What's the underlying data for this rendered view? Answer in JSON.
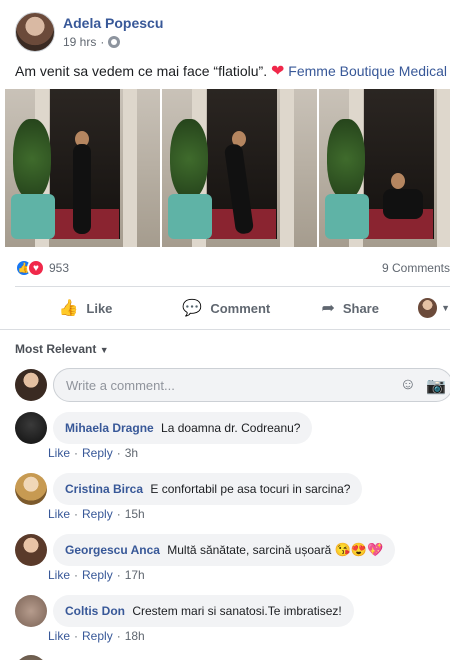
{
  "post": {
    "author": "Adela Popescu",
    "time": "19 hrs",
    "separator": "·",
    "text": "Am venit sa vedem ce mai face “flatiolu”.",
    "page_link": "Femme Boutique Medical",
    "photos_count_shown": 3
  },
  "reactions": {
    "count": "953",
    "comments": "9 Comments"
  },
  "actions": {
    "like": "Like",
    "comment": "Comment",
    "share": "Share"
  },
  "comments_section": {
    "sort_label": "Most Relevant",
    "write_placeholder": "Write a comment...",
    "comments": [
      {
        "author": "Mihaela Dragne",
        "text": "La doamna dr. Codreanu?",
        "emoji": "",
        "like": "Like",
        "reply": "Reply",
        "time": "3h"
      },
      {
        "author": "Cristina Birca",
        "text": "E confortabil pe asa tocuri in sarcina?",
        "emoji": "",
        "like": "Like",
        "reply": "Reply",
        "time": "15h"
      },
      {
        "author": "Georgescu Anca",
        "text": "Multă sănătate, sarcină ușoară",
        "emoji": "😘😍💖",
        "like": "Like",
        "reply": "Reply",
        "time": "17h"
      },
      {
        "author": "Coltis Don",
        "text": "Crestem mari si sanatosi.Te imbratisez!",
        "emoji": "",
        "like": "Like",
        "reply": "Reply",
        "time": "18h"
      }
    ]
  },
  "colors": {
    "link": "#385898",
    "like_blue": "#1877f2",
    "love_red": "#f0284a",
    "bubble_bg": "#f2f3f5"
  }
}
